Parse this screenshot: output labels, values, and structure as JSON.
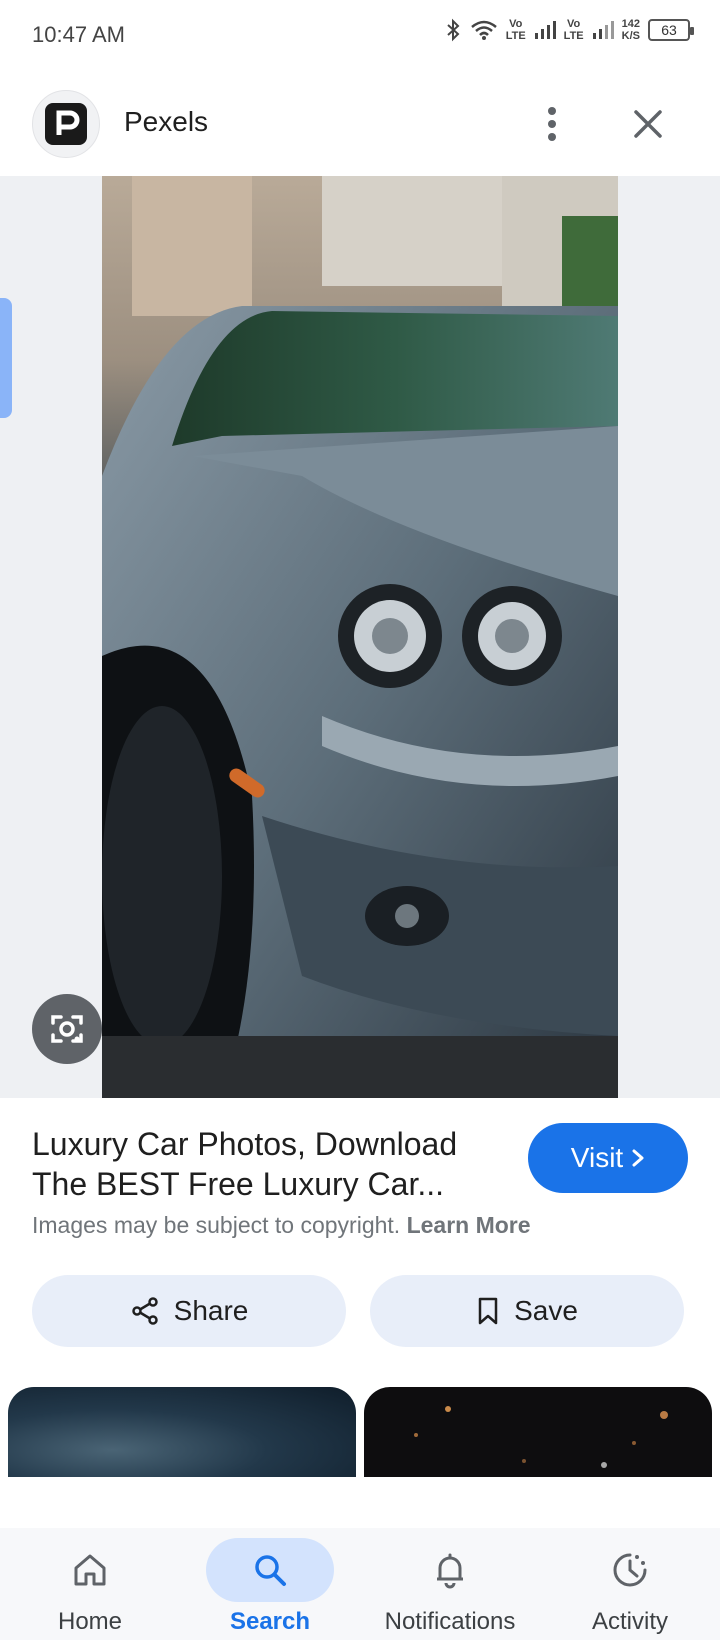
{
  "status_bar": {
    "time": "10:47 AM",
    "net1": "Vo\nLTE",
    "net2": "Vo\nLTE",
    "speed": "142\nK/S",
    "battery": "63"
  },
  "header": {
    "site_name": "Pexels",
    "logo_icon": "pexels-logo-icon",
    "more_icon": "more-vert-icon",
    "close_icon": "close-icon"
  },
  "result": {
    "title": "Luxury Car Photos, Download The BEST Free Luxury Car...",
    "visit_label": "Visit",
    "copyright_text": "Images may be subject to copyright.",
    "learn_more": "Learn More",
    "share_label": "Share",
    "save_label": "Save"
  },
  "bottom_nav": {
    "items": [
      {
        "label": "Home",
        "icon": "home-icon"
      },
      {
        "label": "Search",
        "icon": "search-icon"
      },
      {
        "label": "Notifications",
        "icon": "bell-icon"
      },
      {
        "label": "Activity",
        "icon": "activity-icon"
      }
    ]
  },
  "colors": {
    "accent": "#1a73e8",
    "action_bg": "#e8eef9",
    "nav_active_bg": "#d3e3fd"
  }
}
